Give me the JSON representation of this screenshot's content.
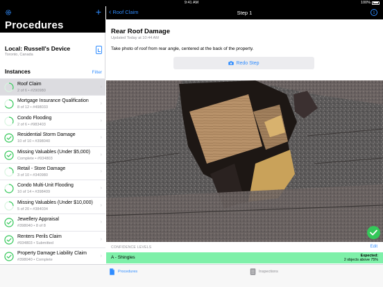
{
  "status_bar": {
    "time": "9:41 AM",
    "battery": "100%"
  },
  "sidebar": {
    "title": "Procedures",
    "device": {
      "name": "Local: Russell's Device",
      "location": "Toronto, Canada"
    },
    "instances_label": "Instances",
    "filter_label": "Filter",
    "instances": [
      {
        "name": "Roof Claim",
        "subtitle": "2 of 6 • #290980",
        "status": "in-progress",
        "progress": 0.33,
        "selected": true
      },
      {
        "name": "Mortgage Insurance Qualification",
        "subtitle": "8 of 12 • #498033",
        "status": "in-progress",
        "progress": 0.67
      },
      {
        "name": "Condo Flooding",
        "subtitle": "2 of 6 • #983403",
        "status": "in-progress",
        "progress": 0.33
      },
      {
        "name": "Residential Storm Damage",
        "subtitle": "10 of 10 • #398040",
        "status": "complete",
        "progress": 1
      },
      {
        "name": "Missing Valuables (Under $5,000)",
        "subtitle": "Complete • #934803",
        "status": "complete",
        "progress": 1
      },
      {
        "name": "Retail - Store Damage",
        "subtitle": "3 of 10 • #340980",
        "status": "in-progress",
        "progress": 0.3
      },
      {
        "name": "Condo Multi-Unit Flooding",
        "subtitle": "10 of 14 • #398409",
        "status": "in-progress",
        "progress": 0.71
      },
      {
        "name": "Missing Valuables (Under $10,000)",
        "subtitle": "5 of 20 • #384034",
        "status": "in-progress",
        "progress": 0.25
      },
      {
        "name": "Jewellery Appraisal",
        "subtitle": "#398040 • 8 of 8",
        "status": "complete",
        "progress": 1
      },
      {
        "name": "Renters Perils Claim",
        "subtitle": "#934803 • Submitted",
        "status": "complete",
        "progress": 1
      },
      {
        "name": "Property Damage Liability Claim",
        "subtitle": "#398040 • Complete",
        "status": "complete",
        "progress": 1
      }
    ]
  },
  "nav": {
    "back_label": "Roof Claim",
    "title": "Step 1"
  },
  "step": {
    "title": "Rear Roof Damage",
    "updated": "Updated Today at 10:44 AM",
    "instruction": "Take photo of roof from rear angle, centered at the back of the property.",
    "redo_label": "Redo Step"
  },
  "confidence": {
    "header": "CONFIDENCE LEVELS",
    "edit_label": "Edit",
    "row_label": "A - Shingles",
    "expected_label": "Expected:",
    "expected_value": "2 objects above 75%"
  },
  "tabs": [
    {
      "label": "Procedures",
      "active": true
    },
    {
      "label": "Inspections",
      "active": false
    }
  ],
  "colors": {
    "accent": "#2f8cff",
    "success": "#34c759",
    "confidence_row": "#7ef0a9",
    "selected_row": "#dcdce0"
  }
}
